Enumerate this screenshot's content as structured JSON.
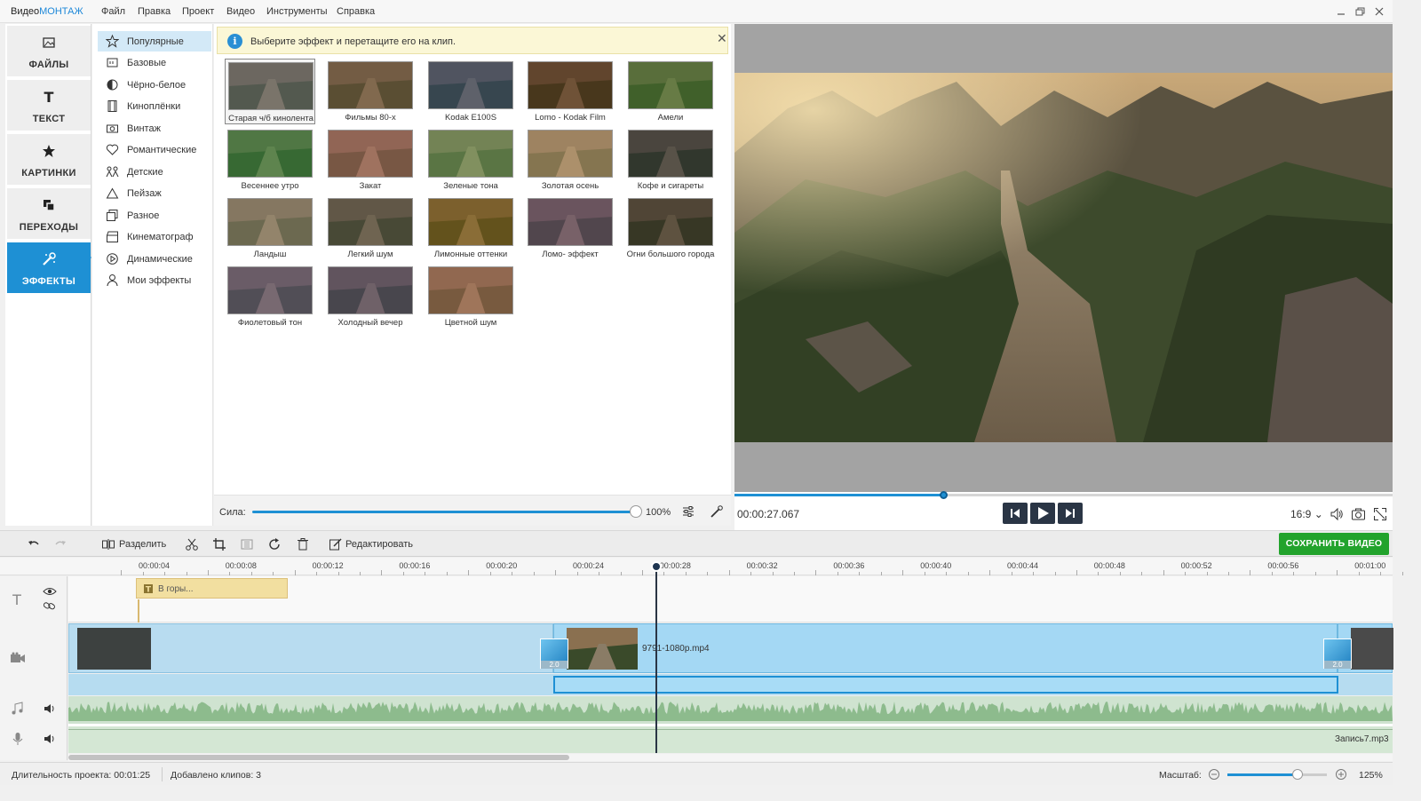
{
  "app": {
    "logo_prefix": "Видео",
    "logo_suffix": "МОНТАЖ"
  },
  "menu": [
    "Файл",
    "Правка",
    "Проект",
    "Видео",
    "Инструменты",
    "Справка"
  ],
  "tabs": [
    {
      "label": "ФАЙЛЫ",
      "icon": "image-icon"
    },
    {
      "label": "ТЕКСТ",
      "icon": "text-icon"
    },
    {
      "label": "КАРТИНКИ",
      "icon": "star-icon"
    },
    {
      "label": "ПЕРЕХОДЫ",
      "icon": "transitions-icon"
    },
    {
      "label": "ЭФФЕКТЫ",
      "icon": "magic-wand-icon",
      "active": true
    }
  ],
  "categories": [
    {
      "label": "Популярные",
      "active": true
    },
    {
      "label": "Базовые"
    },
    {
      "label": "Чёрно-белое"
    },
    {
      "label": "Киноплёнки"
    },
    {
      "label": "Винтаж"
    },
    {
      "label": "Романтические"
    },
    {
      "label": "Детские"
    },
    {
      "label": "Пейзаж"
    },
    {
      "label": "Разное"
    },
    {
      "label": "Кинематограф"
    },
    {
      "label": "Динамические"
    },
    {
      "label": "Мои эффекты"
    }
  ],
  "hint": "Выберите эффект и перетащите его на клип.",
  "effects": [
    {
      "label": "Старая ч/б кинолента",
      "tint": "#6e6e6e",
      "selected": true
    },
    {
      "label": "Фильмы 80-х",
      "tint": "#7a5a3a"
    },
    {
      "label": "Kodak E100S",
      "tint": "#3a4a6e"
    },
    {
      "label": "Lomo - Kodak Film",
      "tint": "#5a3010"
    },
    {
      "label": "Амели",
      "tint": "#4a7a2a"
    },
    {
      "label": "Весеннее утро",
      "tint": "#3a8a3a"
    },
    {
      "label": "Закат",
      "tint": "#b06a5a"
    },
    {
      "label": "Зеленые тона",
      "tint": "#7aa05a"
    },
    {
      "label": "Золотая осень",
      "tint": "#c8a070"
    },
    {
      "label": "Кофе и сигареты",
      "tint": "#303030"
    },
    {
      "label": "Ландыш",
      "tint": "#9a8a70"
    },
    {
      "label": "Легкий шум",
      "tint": "#5a5040"
    },
    {
      "label": "Лимонные оттенки",
      "tint": "#8a6010"
    },
    {
      "label": "Ломо- эффект",
      "tint": "#6a4a6a"
    },
    {
      "label": "Огни большого города",
      "tint": "#3a3020"
    },
    {
      "label": "Фиолетовый тон",
      "tint": "#6a5a7a"
    },
    {
      "label": "Холодный вечер",
      "tint": "#5a4a6a"
    },
    {
      "label": "Цветной шум",
      "tint": "#b07050"
    }
  ],
  "strength": {
    "label": "Сила:",
    "value": "100%",
    "level": 1.0
  },
  "preview": {
    "timecode": "00:00:27.067",
    "ratio": "16:9",
    "progress": 0.318
  },
  "toolbar": {
    "split": "Разделить",
    "edit": "Редактировать",
    "save": "СОХРАНИТЬ ВИДЕО"
  },
  "ruler": [
    "00:00:04",
    "00:00:08",
    "00:00:12",
    "00:00:16",
    "00:00:20",
    "00:00:24",
    "00:00:28",
    "00:00:32",
    "00:00:36",
    "00:00:40",
    "00:00:44",
    "00:00:48",
    "00:00:52",
    "00:00:56",
    "00:01:00"
  ],
  "timeline": {
    "title_clip": "В горы...",
    "video_clip": "9791-1080p.mp4",
    "audio_clip": "Запись7.mp3",
    "transition_a": "2.0",
    "transition_b": "2.0"
  },
  "status": {
    "duration": "Длительность проекта:  00:01:25",
    "clips": "Добавлено клипов: 3",
    "zoom_label": "Масштаб:",
    "zoom_value": "125%",
    "zoom_level": 0.7
  },
  "colors": {
    "accent": "#1e90d4",
    "save": "#22a32c"
  }
}
